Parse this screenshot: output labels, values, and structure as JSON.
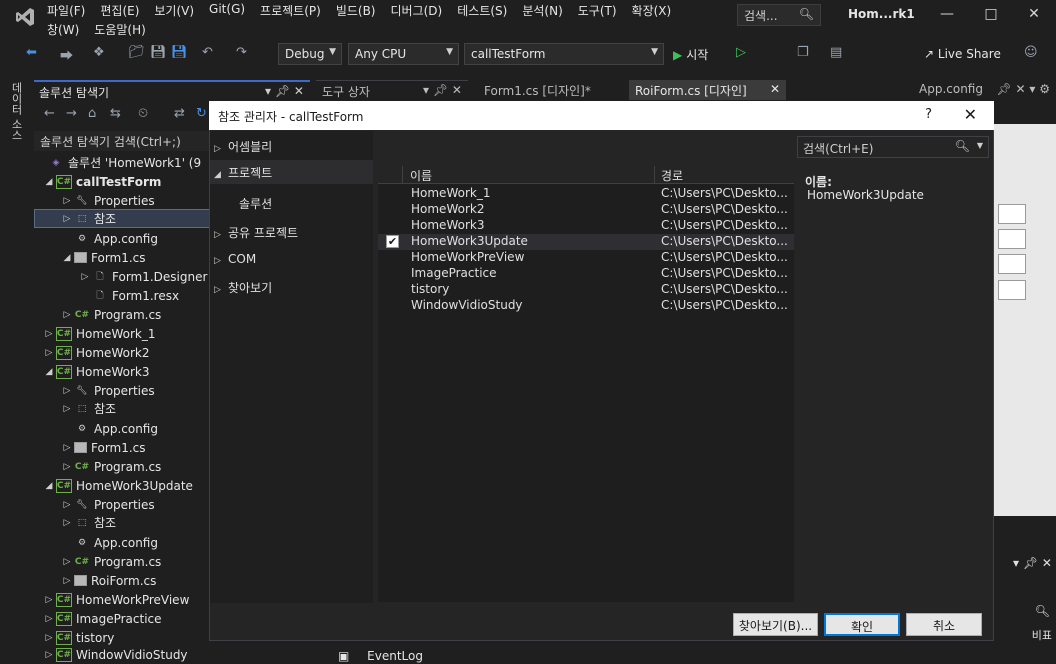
{
  "menu": {
    "row1": [
      "파일(F)",
      "편집(E)",
      "보기(V)",
      "Git(G)",
      "프로젝트(P)",
      "빌드(B)",
      "디버그(D)",
      "테스트(S)",
      "분석(N)",
      "도구(T)",
      "확장(X)"
    ],
    "row2": [
      "창(W)",
      "도움말(H)"
    ],
    "search_label": "검색...",
    "window_title": "Hom...rk1"
  },
  "toolbar": {
    "config": "Debug",
    "platform": "Any CPU",
    "startup_project": "callTestForm",
    "start_label": "시작",
    "live_share": "Live Share"
  },
  "side_strip": {
    "label": "데이터 소스"
  },
  "solution_explorer": {
    "title": "솔루션 탐색기",
    "search_placeholder": "솔루션 탐색기 검색(Ctrl+;)",
    "solution_label": "솔루션 'HomeWork1' (9",
    "items": [
      {
        "label": "callTestForm",
        "bold": true
      },
      {
        "label": "Properties"
      },
      {
        "label": "참조"
      },
      {
        "label": "App.config"
      },
      {
        "label": "Form1.cs"
      },
      {
        "label": "Form1.Designer"
      },
      {
        "label": "Form1.resx"
      },
      {
        "label": "Program.cs"
      },
      {
        "label": "HomeWork_1"
      },
      {
        "label": "HomeWork2"
      },
      {
        "label": "HomeWork3"
      },
      {
        "label": "Properties"
      },
      {
        "label": "참조"
      },
      {
        "label": "App.config"
      },
      {
        "label": "Form1.cs"
      },
      {
        "label": "Program.cs"
      },
      {
        "label": "HomeWork3Update"
      },
      {
        "label": "Properties"
      },
      {
        "label": "참조"
      },
      {
        "label": "App.config"
      },
      {
        "label": "Program.cs"
      },
      {
        "label": "RoiForm.cs"
      },
      {
        "label": "HomeWorkPreView"
      },
      {
        "label": "ImagePractice"
      },
      {
        "label": "tistory"
      },
      {
        "label": "WindowVidioStudy"
      }
    ]
  },
  "editor_tabs": {
    "toolbox": "도구 상자",
    "form1": "Form1.cs [디자인]*",
    "roiform": "RoiForm.cs [디자인]",
    "appconfig": "App.config"
  },
  "bottom": {
    "eventlog": "EventLog",
    "props_label": "비표"
  },
  "dialog": {
    "title": "참조 관리자 - callTestForm",
    "nav": [
      "어셈블리",
      "프로젝트",
      "솔루션",
      "공유 프로젝트",
      "COM",
      "찾아보기"
    ],
    "search_placeholder": "검색(Ctrl+E)",
    "col_name": "이름",
    "col_path": "경로",
    "rows": [
      {
        "name": "HomeWork_1",
        "path": "C:\\Users\\PC\\Deskto...",
        "checked": false
      },
      {
        "name": "HomeWork2",
        "path": "C:\\Users\\PC\\Deskto...",
        "checked": false
      },
      {
        "name": "HomeWork3",
        "path": "C:\\Users\\PC\\Deskto...",
        "checked": false
      },
      {
        "name": "HomeWork3Update",
        "path": "C:\\Users\\PC\\Deskto...",
        "checked": true
      },
      {
        "name": "HomeWorkPreView",
        "path": "C:\\Users\\PC\\Deskto...",
        "checked": false
      },
      {
        "name": "ImagePractice",
        "path": "C:\\Users\\PC\\Deskto...",
        "checked": false
      },
      {
        "name": "tistory",
        "path": "C:\\Users\\PC\\Deskto...",
        "checked": false
      },
      {
        "name": "WindowVidioStudy",
        "path": "C:\\Users\\PC\\Deskto...",
        "checked": false
      }
    ],
    "detail_label": "이름:",
    "detail_value": "HomeWork3Update",
    "browse_button": "찾아보기(B)...",
    "ok_button": "확인",
    "cancel_button": "취소"
  }
}
